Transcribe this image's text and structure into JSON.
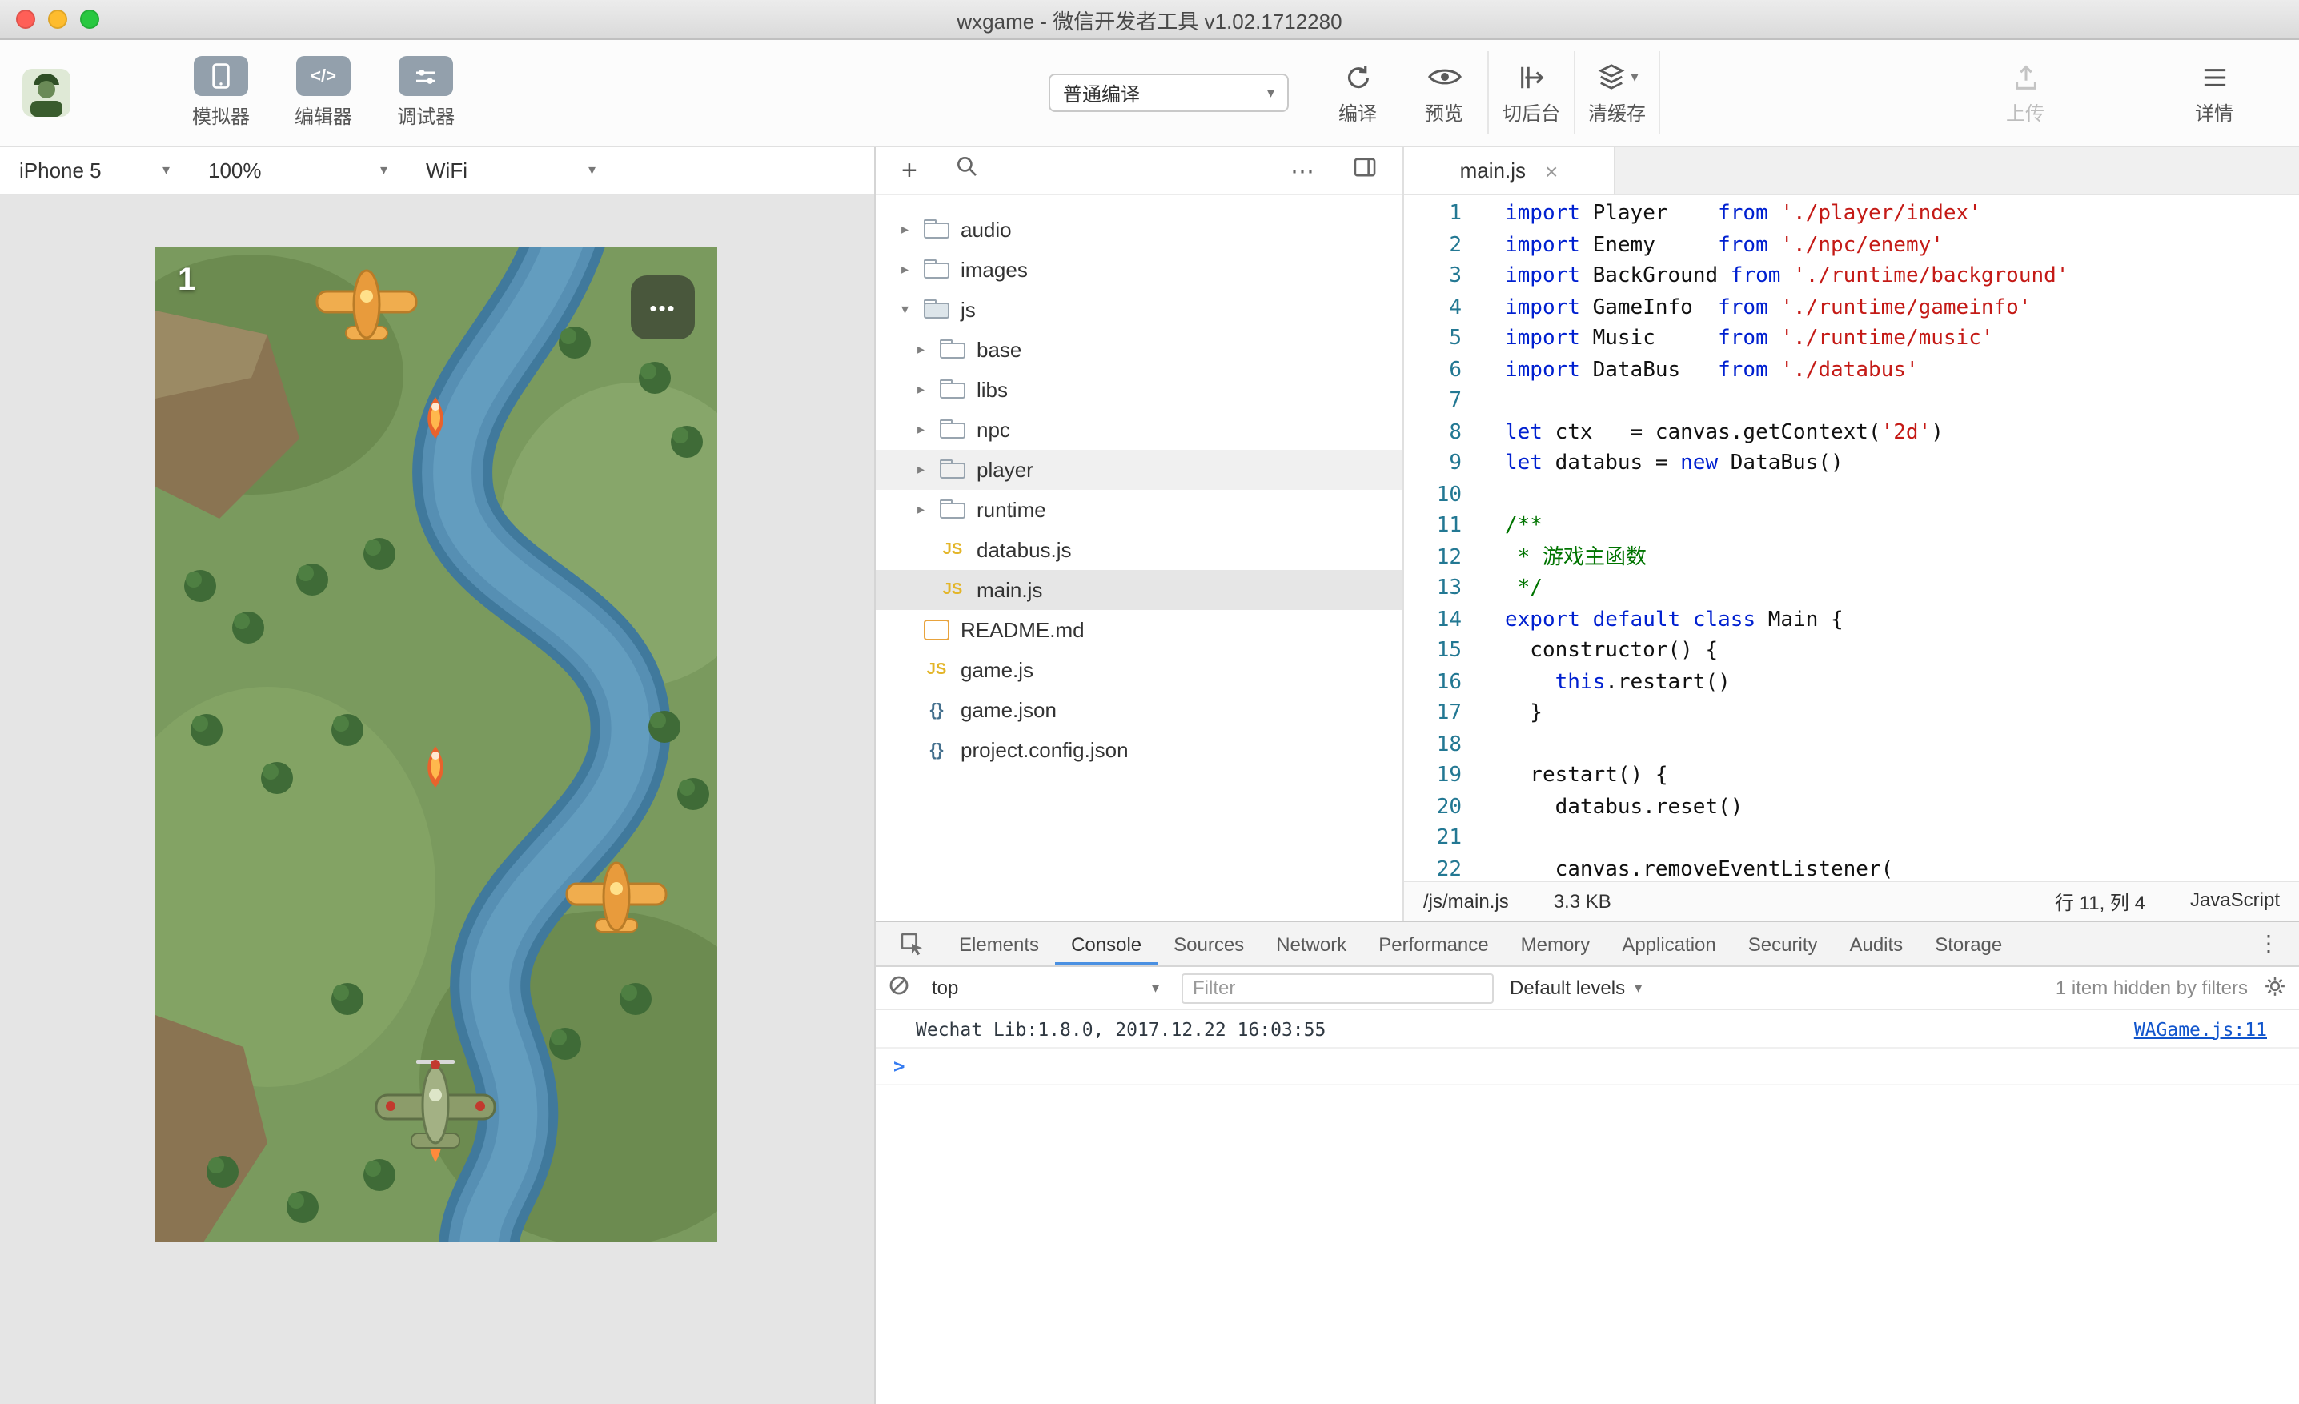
{
  "titlebar": {
    "title": "wxgame - 微信开发者工具 v1.02.1712280"
  },
  "icons": {
    "chevron_down": "▾",
    "chevron_right": "▸",
    "plus": "+",
    "more_h": "⋯",
    "more_v": "⋮",
    "close": "×",
    "editor_glyph": "</>"
  },
  "toolbar": {
    "simulator_label": "模拟器",
    "editor_label": "编辑器",
    "debugger_label": "调试器",
    "compile_mode": "普通编译",
    "compile_label": "编译",
    "preview_label": "预览",
    "background_label": "切后台",
    "cache_label": "清缓存",
    "upload_label": "上传",
    "details_label": "详情"
  },
  "simulator": {
    "device": "iPhone 5",
    "zoom": "100%",
    "network": "WiFi",
    "game": {
      "score": "1",
      "menu_dots": "•••"
    }
  },
  "file_panel": {
    "items": [
      {
        "label": "audio",
        "icon": "folder",
        "depth": 0,
        "arrow": "collapsed"
      },
      {
        "label": "images",
        "icon": "folder",
        "depth": 0,
        "arrow": "collapsed"
      },
      {
        "label": "js",
        "icon": "folder-open",
        "depth": 0,
        "arrow": "expanded"
      },
      {
        "label": "base",
        "icon": "folder",
        "depth": 1,
        "arrow": "collapsed"
      },
      {
        "label": "libs",
        "icon": "folder",
        "depth": 1,
        "arrow": "collapsed"
      },
      {
        "label": "npc",
        "icon": "folder",
        "depth": 1,
        "arrow": "collapsed"
      },
      {
        "label": "player",
        "icon": "folder",
        "depth": 1,
        "arrow": "collapsed",
        "state": "hover"
      },
      {
        "label": "runtime",
        "icon": "folder",
        "depth": 1,
        "arrow": "collapsed"
      },
      {
        "label": "databus.js",
        "icon": "js",
        "depth": 1
      },
      {
        "label": "main.js",
        "icon": "js",
        "depth": 1,
        "state": "selected"
      },
      {
        "label": "README.md",
        "icon": "md",
        "depth": 0
      },
      {
        "label": "game.js",
        "icon": "js",
        "depth": 0
      },
      {
        "label": "game.json",
        "icon": "json",
        "depth": 0
      },
      {
        "label": "project.config.json",
        "icon": "json",
        "depth": 0
      }
    ]
  },
  "editor": {
    "tab_title": "main.js",
    "lines": [
      {
        "n": 1,
        "t": [
          [
            "k",
            "import"
          ],
          [
            "p",
            " Player    "
          ],
          [
            "k",
            "from"
          ],
          [
            "p",
            " "
          ],
          [
            "s",
            "'./player/index'"
          ]
        ]
      },
      {
        "n": 2,
        "t": [
          [
            "k",
            "import"
          ],
          [
            "p",
            " Enemy     "
          ],
          [
            "k",
            "from"
          ],
          [
            "p",
            " "
          ],
          [
            "s",
            "'./npc/enemy'"
          ]
        ]
      },
      {
        "n": 3,
        "t": [
          [
            "k",
            "import"
          ],
          [
            "p",
            " BackGround "
          ],
          [
            "k",
            "from"
          ],
          [
            "p",
            " "
          ],
          [
            "s",
            "'./runtime/background'"
          ]
        ]
      },
      {
        "n": 4,
        "t": [
          [
            "k",
            "import"
          ],
          [
            "p",
            " GameInfo  "
          ],
          [
            "k",
            "from"
          ],
          [
            "p",
            " "
          ],
          [
            "s",
            "'./runtime/gameinfo'"
          ]
        ]
      },
      {
        "n": 5,
        "t": [
          [
            "k",
            "import"
          ],
          [
            "p",
            " Music     "
          ],
          [
            "k",
            "from"
          ],
          [
            "p",
            " "
          ],
          [
            "s",
            "'./runtime/music'"
          ]
        ]
      },
      {
        "n": 6,
        "t": [
          [
            "k",
            "import"
          ],
          [
            "p",
            " DataBus   "
          ],
          [
            "k",
            "from"
          ],
          [
            "p",
            " "
          ],
          [
            "s",
            "'./databus'"
          ]
        ]
      },
      {
        "n": 7,
        "t": []
      },
      {
        "n": 8,
        "t": [
          [
            "k",
            "let"
          ],
          [
            "p",
            " ctx   = canvas.getContext("
          ],
          [
            "s",
            "'2d'"
          ],
          [
            "p",
            ")"
          ]
        ]
      },
      {
        "n": 9,
        "t": [
          [
            "k",
            "let"
          ],
          [
            "p",
            " databus = "
          ],
          [
            "k",
            "new"
          ],
          [
            "p",
            " DataBus()"
          ]
        ]
      },
      {
        "n": 10,
        "t": []
      },
      {
        "n": 11,
        "t": [
          [
            "c",
            "/**"
          ]
        ]
      },
      {
        "n": 12,
        "t": [
          [
            "c",
            " * 游戏主函数"
          ]
        ]
      },
      {
        "n": 13,
        "t": [
          [
            "c",
            " */"
          ]
        ]
      },
      {
        "n": 14,
        "t": [
          [
            "k",
            "export"
          ],
          [
            "p",
            " "
          ],
          [
            "k",
            "default"
          ],
          [
            "p",
            " "
          ],
          [
            "k",
            "class"
          ],
          [
            "p",
            " Main {"
          ]
        ]
      },
      {
        "n": 15,
        "t": [
          [
            "p",
            "  constructor() {"
          ]
        ]
      },
      {
        "n": 16,
        "t": [
          [
            "p",
            "    "
          ],
          [
            "k",
            "this"
          ],
          [
            "p",
            ".restart()"
          ]
        ]
      },
      {
        "n": 17,
        "t": [
          [
            "p",
            "  }"
          ]
        ]
      },
      {
        "n": 18,
        "t": []
      },
      {
        "n": 19,
        "t": [
          [
            "p",
            "  restart() {"
          ]
        ]
      },
      {
        "n": 20,
        "t": [
          [
            "p",
            "    databus.reset()"
          ]
        ]
      },
      {
        "n": 21,
        "t": []
      },
      {
        "n": 22,
        "t": [
          [
            "p",
            "    canvas.removeEventListener("
          ]
        ]
      }
    ],
    "statusbar": {
      "path": "/js/main.js",
      "size": "3.3 KB",
      "cursor": "行 11, 列 4",
      "language": "JavaScript"
    }
  },
  "devtools": {
    "tabs": [
      "Elements",
      "Console",
      "Sources",
      "Network",
      "Performance",
      "Memory",
      "Application",
      "Security",
      "Audits",
      "Storage"
    ],
    "active_tab": "Console",
    "toolbar": {
      "context": "top",
      "filter_placeholder": "Filter",
      "levels_label": "Default levels",
      "hidden_note": "1 item hidden by filters"
    },
    "console": {
      "message": "Wechat Lib:1.8.0, 2017.12.22 16:03:55",
      "source_link": "WAGame.js:11",
      "prompt": ">"
    }
  },
  "colors": {
    "keyword": "#0020d0",
    "string": "#c41a16",
    "comment": "#007400",
    "line_number": "#237893",
    "js_icon": "#e3b528",
    "link": "#1155cc",
    "prompt": "#367cf1",
    "traffic_red": "#ff5f57",
    "traffic_yellow": "#febc2e",
    "traffic_green": "#28c840"
  }
}
